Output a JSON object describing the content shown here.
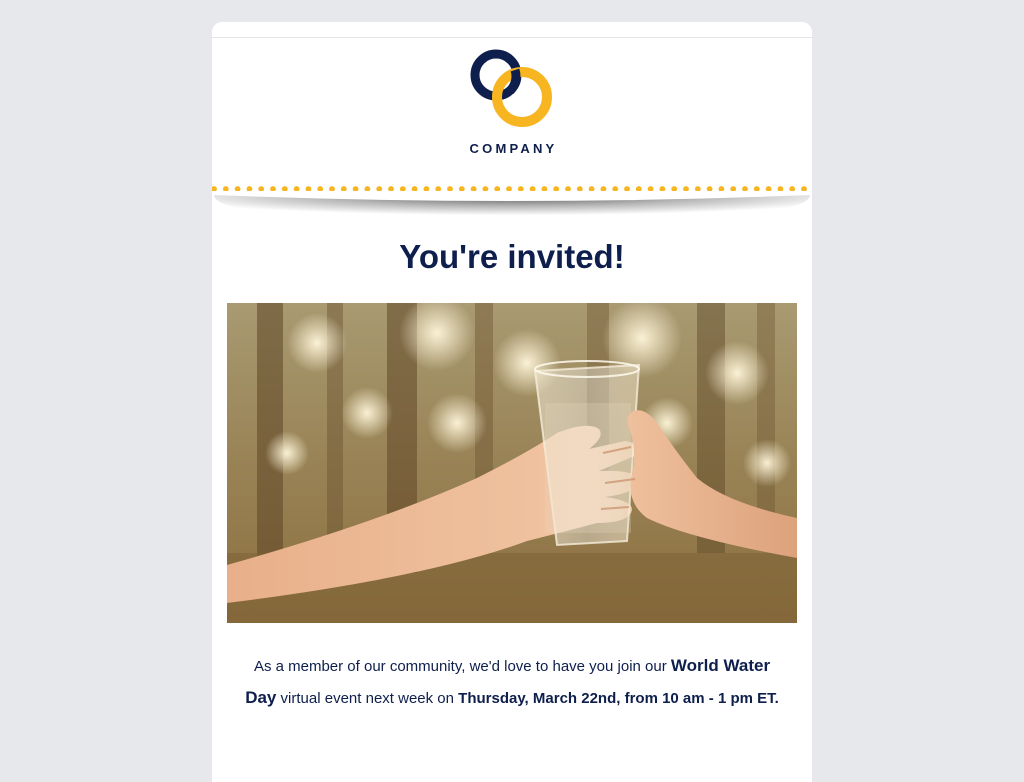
{
  "brand": {
    "name": "COMPANY",
    "colors": {
      "navy": "#0e1f4d",
      "gold": "#f7b521",
      "background": "#e6e8ec"
    }
  },
  "header": {
    "logo_icon": "interlocking-rings-logo"
  },
  "hero": {
    "title": "You're invited!",
    "image": "hands-sharing-glass-of-water-photo"
  },
  "body": {
    "intro": "As a member of our community, we'd love to have you join our ",
    "event_name": "World Water Day",
    "middle": " virtual event next week on ",
    "date_time": "Thursday, March 22nd, from 10 am  -  1 pm ET."
  }
}
